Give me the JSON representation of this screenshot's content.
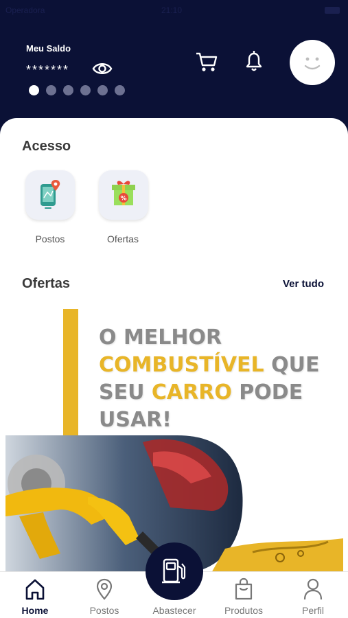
{
  "statusbar": {
    "carrier": "Operadora",
    "time": "21:10"
  },
  "header": {
    "saldo_label": "Meu Saldo",
    "saldo_value": "*******",
    "carousel_dots": 6,
    "active_dot": 0
  },
  "acesso": {
    "title": "Acesso",
    "items": [
      {
        "label": "Postos",
        "icon": "map-pin-phone-icon"
      },
      {
        "label": "Ofertas",
        "icon": "gift-discount-icon"
      }
    ]
  },
  "ofertas": {
    "title": "Ofertas",
    "ver_tudo": "Ver tudo",
    "banner": {
      "line1": "O MELHOR",
      "line2a": "COMBUSTÍVEL",
      "line2b": " QUE",
      "line3a": "SEU ",
      "line3b": "CARRO",
      "line3c": " PODE",
      "line4": "USAR!"
    }
  },
  "navbar": {
    "items": [
      {
        "label": "Home",
        "icon": "home-icon",
        "active": true
      },
      {
        "label": "Postos",
        "icon": "location-pin-icon",
        "active": false
      },
      {
        "label": "Abastecer",
        "icon": "fuel-pump-icon",
        "active": false
      },
      {
        "label": "Produtos",
        "icon": "shopping-bag-icon",
        "active": false
      },
      {
        "label": "Perfil",
        "icon": "user-icon",
        "active": false
      }
    ]
  },
  "colors": {
    "navy": "#0b1136",
    "accent_yellow": "#e8b528",
    "banner_gray": "#8a8a8a"
  }
}
